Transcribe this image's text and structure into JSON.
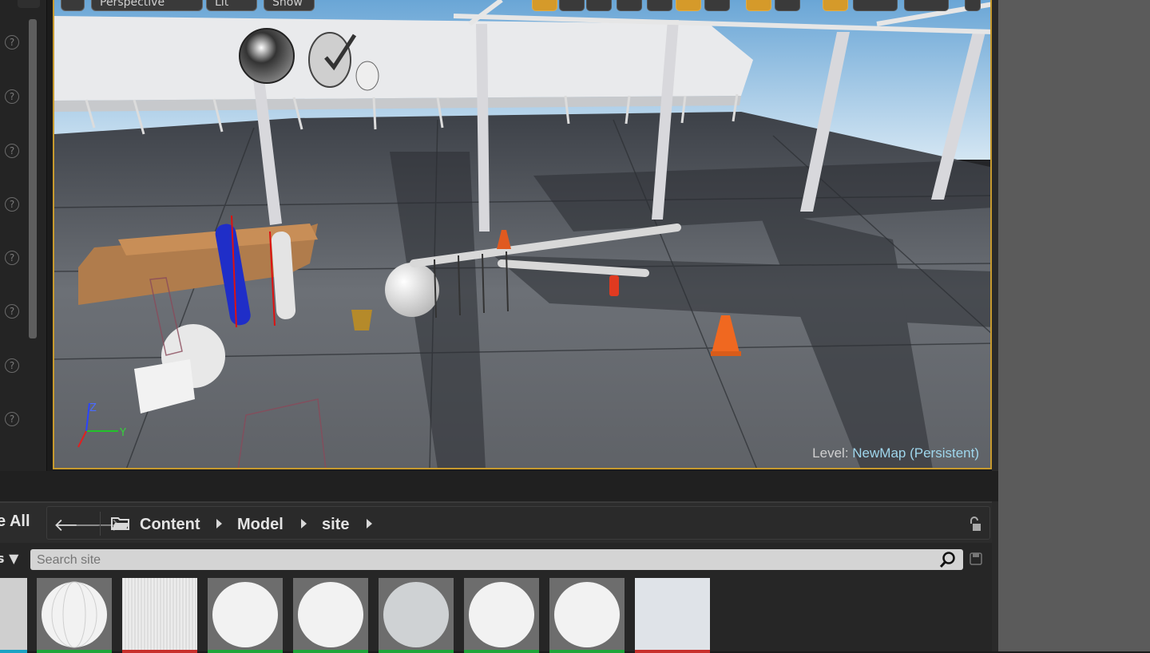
{
  "viewport": {
    "toolbar": {
      "view_mode": "Perspective",
      "lighting": "Lit",
      "show": "Show"
    },
    "level_prefix": "Level:",
    "level_name": "NewMap (Persistent)",
    "axis_labels": {
      "z": "Z",
      "y": "Y"
    }
  },
  "content_browser": {
    "save_all": "e All",
    "filters_partial": "s",
    "path": [
      "Content",
      "Model",
      "site"
    ],
    "search_placeholder": "Search site",
    "assets": [
      {
        "kind": "sphere-ribbed",
        "bar": "#1fa53a"
      },
      {
        "kind": "texture-stripes",
        "bar": "#c8302c"
      },
      {
        "kind": "sphere",
        "bar": "#1fa53a"
      },
      {
        "kind": "sphere",
        "bar": "#1fa53a"
      },
      {
        "kind": "sphere-grey",
        "bar": "#1fa53a"
      },
      {
        "kind": "sphere",
        "bar": "#1fa53a"
      },
      {
        "kind": "sphere",
        "bar": "#1fa53a"
      },
      {
        "kind": "texture-flat",
        "bar": "#c8302c"
      }
    ]
  },
  "colors": {
    "accent": "#c79a2e",
    "active_tool": "#d59a2a",
    "level_name": "#9fd6ec"
  }
}
